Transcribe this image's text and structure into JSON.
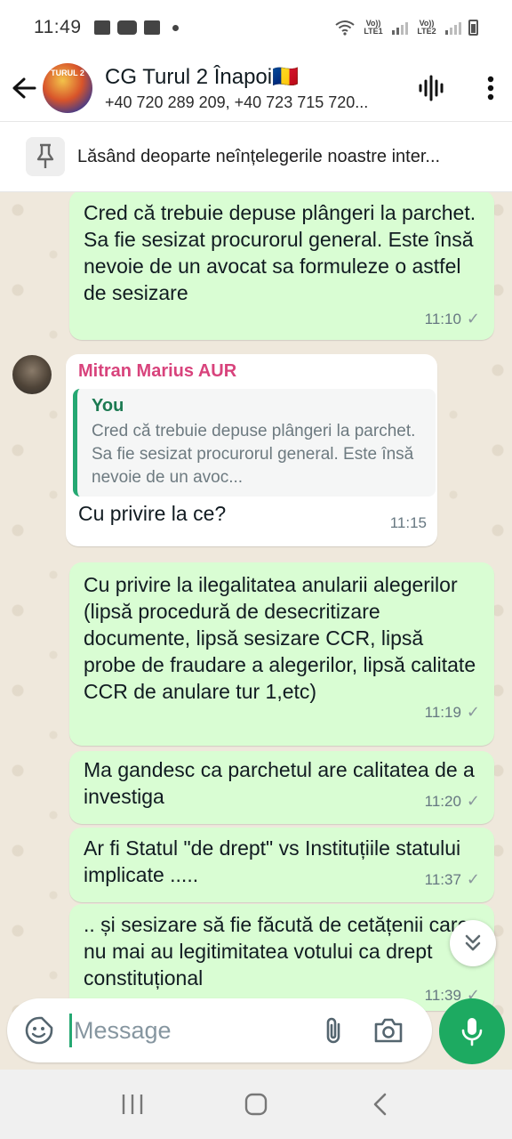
{
  "status_bar": {
    "time": "11:49",
    "net1": "Vo)) LTE1",
    "net2": "Vo)) LTE2"
  },
  "header": {
    "title": "CG Turul 2 Înapoi🇷🇴",
    "subtitle": "+40 720 289 209, +40 723 715 720...",
    "avatar_text": "TURUL 2"
  },
  "pinned": {
    "text": "Lăsând deoparte neînțelegerile noastre inter..."
  },
  "messages": [
    {
      "type": "out",
      "text": "Cred că trebuie depuse plângeri la parchet. Sa fie sesizat procurorul general. Este însă nevoie de un avocat sa formuleze o astfel de sesizare",
      "time": "11:10"
    },
    {
      "type": "in",
      "sender": "Mitran Marius AUR",
      "quote_author": "You",
      "quote_text": "Cred că trebuie depuse plângeri la parchet. Sa fie sesizat procurorul general. Este însă nevoie de un avoc...",
      "text": "Cu privire la ce?",
      "time": "11:15"
    },
    {
      "type": "out",
      "text": "Cu privire la ilegalitatea anularii alegerilor (lipsă procedură de desecritizare documente, lipsă sesizare CCR, lipsă probe de fraudare a alegerilor,  lipsă calitate CCR de anulare tur 1,etc)",
      "time": "11:19"
    },
    {
      "type": "out",
      "text": "Ma gandesc ca parchetul  are calitatea de a investiga",
      "time": "11:20"
    },
    {
      "type": "out",
      "text": "Ar fi Statul \"de drept\" vs Instituțiile statului implicate .....",
      "time": "11:37"
    },
    {
      "type": "out",
      "text": ".. și sesizare să fie făcută de cetățenii care nu mai au legitimitatea votului ca drept constituțional",
      "time": "11:39"
    }
  ],
  "composer": {
    "placeholder": "Message"
  },
  "colors": {
    "outgoing_bubble": "#d9fdd3",
    "incoming_bubble": "#ffffff",
    "accent_green": "#1daa61",
    "sender_name": "#d8437c",
    "chat_background": "#efe8dc"
  },
  "icons": [
    "back-arrow-icon",
    "voice-chat-icon",
    "more-vert-icon",
    "pin-icon",
    "double-chevron-down-icon",
    "sticker-icon",
    "attach-icon",
    "camera-icon",
    "mic-icon",
    "recents-icon",
    "home-icon",
    "back-nav-icon"
  ]
}
